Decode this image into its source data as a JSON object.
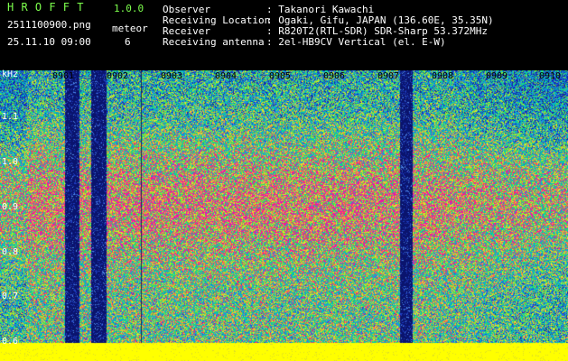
{
  "app": {
    "name": "H R O F F T",
    "version": "1.0.0",
    "filename": "2511100900.png",
    "datetime": "25.11.10 09:00",
    "meteor_label": "meteor",
    "meteor_count": "6"
  },
  "info": {
    "observer_label": "Observer",
    "observer_value": ": Takanori Kawachi",
    "location_label": "Receiving Location",
    "location_value": ": Ogaki, Gifu, JAPAN (136.60E, 35.35N)",
    "receiver_label": "Receiver",
    "receiver_value": ": R820T2(RTL-SDR) SDR-Sharp 53.372MHz",
    "antenna_label": "Receiving antenna",
    "antenna_value": ": 2el-HB9CV Vertical (el. E-W)"
  },
  "spectrogram": {
    "y_unit": "kHz",
    "y_ticks": [
      "1.1",
      "1.0",
      "0.9",
      "0.8",
      "0.7",
      "0.6"
    ],
    "x_ticks": [
      "0901",
      "0902",
      "0903",
      "0904",
      "0905",
      "0906",
      "0907",
      "0908",
      "0909",
      "0910"
    ],
    "colors": {
      "baseline": "#ffff00",
      "dropout": "#0a1a7a",
      "low": "#1a4fd8",
      "mid": "#00c0c8",
      "high": "#ff2060"
    }
  }
}
